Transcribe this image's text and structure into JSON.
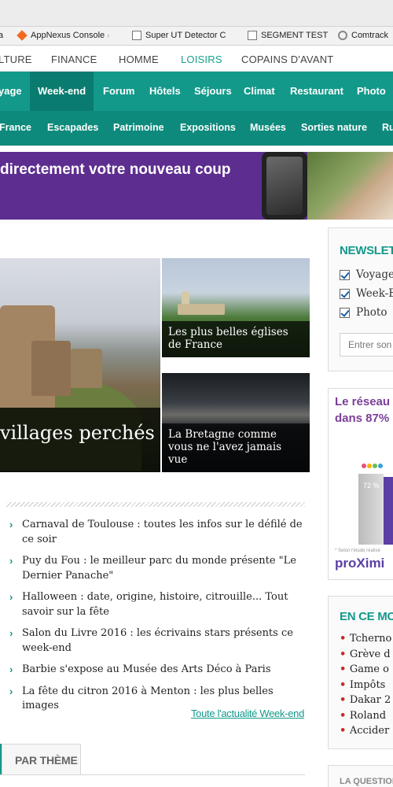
{
  "browser": {
    "bookmarks": [
      {
        "label": "a",
        "icon": "page-icon"
      },
      {
        "label": "AppNexus Console",
        "icon": "appnexus-icon"
      },
      {
        "label": "Super UT Detector C",
        "icon": "document-icon"
      },
      {
        "label": "SEGMENT TEST",
        "icon": "document-icon"
      },
      {
        "label": "Comtrack",
        "icon": "gear-icon"
      }
    ]
  },
  "site_nav": {
    "items": [
      "LTURE",
      "FINANCE",
      "HOMME",
      "LOISIRS",
      "COPAINS D'AVANT"
    ],
    "active": "LOISIRS"
  },
  "primary_nav": {
    "items": [
      "yage",
      "Week-end",
      "Forum",
      "Hôtels",
      "Séjours",
      "Climat",
      "Restaurant",
      "Photo"
    ],
    "active": "Week-end"
  },
  "secondary_nav": {
    "items": [
      "France",
      "Escapades",
      "Patrimoine",
      "Expositions",
      "Musées",
      "Sorties nature",
      "Ru"
    ]
  },
  "banner": {
    "text": "directement votre nouveau coup"
  },
  "hero": {
    "main_caption": "villages perchés",
    "tiles": [
      {
        "caption": "Les plus belles églises de France"
      },
      {
        "caption": "La Bretagne comme vous ne l'avez jamais vue"
      }
    ]
  },
  "news": {
    "items": [
      "Carnaval de Toulouse : toutes les infos sur le défilé de ce soir",
      "Puy du Fou : le meilleur parc du monde présente \"Le Dernier Panache\"",
      "Halloween : date, origine, histoire, citrouille... Tout savoir sur la fête",
      "Salon du Livre 2016 : les écrivains stars présents ce week-end",
      "Barbie s'expose au Musée des Arts Déco à Paris",
      "La fête du citron 2016 à Menton : les plus belles images"
    ],
    "more_link": "Toute l'actualité Week-end"
  },
  "theme_tab": {
    "label": "PAR THÈME"
  },
  "sidebar": {
    "newsletter": {
      "title": "NEWSLETT",
      "options": [
        "Voyage",
        "Week-E",
        "Photo"
      ],
      "input_placeholder": "Entrer son"
    },
    "ad": {
      "line1": "Le réseau",
      "line2": "dans 87%",
      "percent": "72 %",
      "footnote": "* Selon l'étude réalisé",
      "brand": "proXimi"
    },
    "moment": {
      "title": "EN CE MOM",
      "items": [
        "Tcherno",
        "Grève d",
        "Game o",
        "Impôts",
        "Dakar 2",
        "Roland",
        "Accider"
      ]
    },
    "question": {
      "title": "LA QUESTION"
    }
  },
  "colors": {
    "teal": "#12998a",
    "teal_dark": "#0a7c6f",
    "purple": "#5d2d8f",
    "bullet_red": "#cc2a2a"
  }
}
